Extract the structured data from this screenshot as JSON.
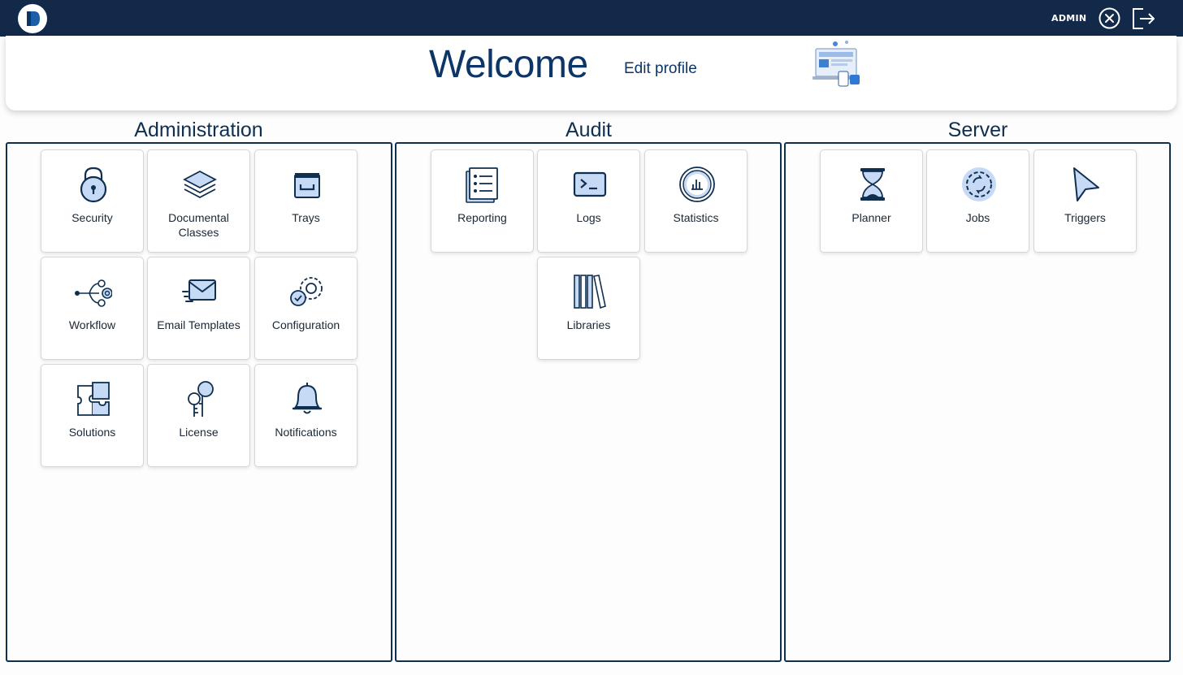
{
  "header": {
    "user": "ADMIN",
    "close_icon": "close-circle-icon",
    "logout_icon": "logout-icon",
    "colors": {
      "topbar": "#13294a",
      "accent": "#0d3566",
      "icon_fill": "#c7daf5"
    }
  },
  "welcome": {
    "title": "Welcome",
    "edit_profile": "Edit profile"
  },
  "sections": {
    "administration": {
      "title": "Administration",
      "tiles": [
        {
          "label": "Security",
          "icon": "padlock-icon"
        },
        {
          "label": "Documental Classes",
          "icon": "layers-icon"
        },
        {
          "label": "Trays",
          "icon": "tray-icon"
        },
        {
          "label": "Workflow",
          "icon": "workflow-icon"
        },
        {
          "label": "Email Templates",
          "icon": "email-icon"
        },
        {
          "label": "Configuration",
          "icon": "gears-icon"
        },
        {
          "label": "Solutions",
          "icon": "puzzle-icon"
        },
        {
          "label": "License",
          "icon": "license-icon"
        },
        {
          "label": "Notifications",
          "icon": "bell-icon"
        }
      ]
    },
    "audit": {
      "title": "Audit",
      "tiles": [
        {
          "label": "Reporting",
          "icon": "report-icon"
        },
        {
          "label": "Logs",
          "icon": "terminal-icon"
        },
        {
          "label": "Statistics",
          "icon": "chart-circle-icon"
        },
        {
          "label": "Libraries",
          "icon": "books-icon"
        }
      ]
    },
    "server": {
      "title": "Server",
      "tiles": [
        {
          "label": "Planner",
          "icon": "hourglass-icon"
        },
        {
          "label": "Jobs",
          "icon": "gear-sync-icon"
        },
        {
          "label": "Triggers",
          "icon": "cursor-icon"
        }
      ]
    }
  }
}
